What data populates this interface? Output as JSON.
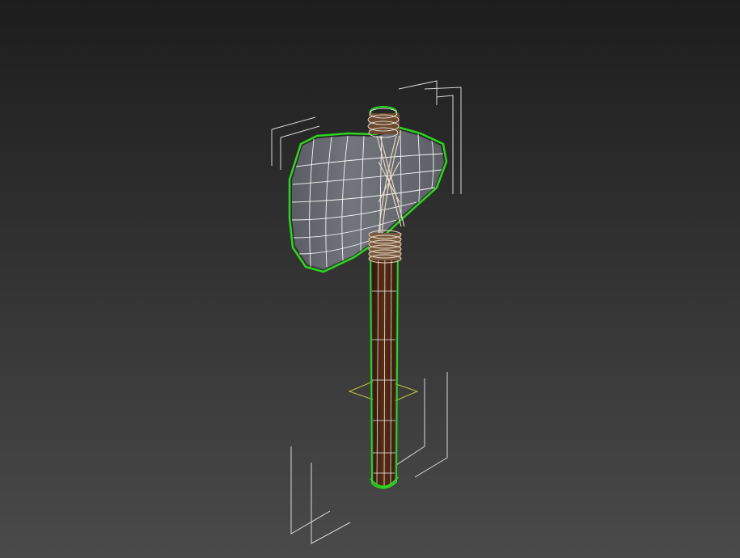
{
  "viewport": {
    "background_top": "#1d1d1d",
    "background_bottom": "#4a4a4a"
  },
  "colors": {
    "selection_outline": "#2bd61e",
    "wireframe": "#ffffff",
    "bounding_box": "#d9d9d9",
    "pivot_gizmo": "#c9c14a",
    "axe_blade": "#6a6d72",
    "axe_blade_shadow": "#555860",
    "axe_handle": "#4a2410",
    "axe_handle_dark": "#2f160a",
    "binding_wrap": "#d8c8b2"
  },
  "scene": {
    "object": "axe-model",
    "selected": true
  }
}
